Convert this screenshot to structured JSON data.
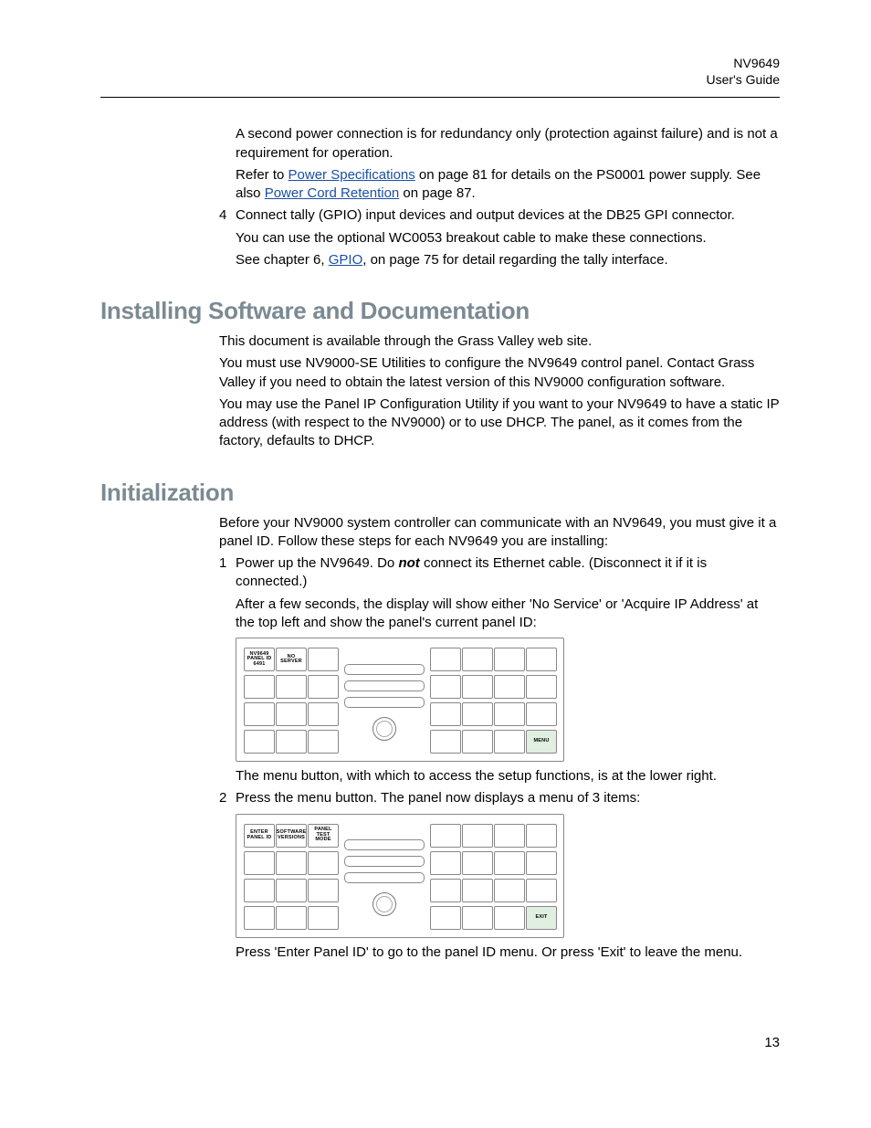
{
  "header": {
    "product": "NV9649",
    "doc": "User's Guide"
  },
  "intro": {
    "p1": "A second power connection is for redundancy only (protection against failure) and is not a requirement for operation.",
    "p2_a": "Refer to ",
    "p2_link1": "Power Specifications",
    "p2_b": " on page 81 for details on the PS0001 power supply. See also ",
    "p2_link2": "Power Cord Retention",
    "p2_c": " on page 87."
  },
  "step4": {
    "num": "4",
    "line1": "Connect tally (GPIO) input devices and output devices at the DB25 GPI connector.",
    "line2": "You can use the optional WC0053 breakout cable to make these connections.",
    "line3_a": "See chapter 6, ",
    "line3_link": "GPIO",
    "line3_b": ", on page 75 for detail regarding the tally interface."
  },
  "install": {
    "title": "Installing Software and Documentation",
    "p1": "This document is available through the Grass Valley web site.",
    "p2": "You must use NV9000-SE Utilities to configure the NV9649 control panel. Contact Grass Valley if you need to obtain the latest version of this NV9000 configuration software.",
    "p3": "You may use the Panel IP Configuration Utility if you want to your NV9649 to have a static IP address (with respect to the NV9000) or to use DHCP. The panel, as it comes from the factory, defaults to DHCP."
  },
  "init": {
    "title": "Initialization",
    "p1": "Before your NV9000 system controller can communicate with an NV9649, you must give it a panel ID. Follow these steps for each NV9649 you are installing:",
    "s1_num": "1",
    "s1_a": "Power up the NV9649. Do ",
    "s1_not": "not",
    "s1_b": " connect its Ethernet cable. (Disconnect it if it is connected.)",
    "s1_p2": "After a few seconds, the display will show either 'No Service' or 'Acquire IP Address' at the top left and show the panel's current panel ID:",
    "panel1": {
      "b1_l1": "NV9649",
      "b1_l2": "PANEL ID",
      "b1_l3": "6491",
      "b2_l1": "NO",
      "b2_l2": "SERVER",
      "menu": "MENU"
    },
    "s1_after": "The menu button, with which to access the setup functions, is at the lower right.",
    "s2_num": "2",
    "s2": "Press the menu button. The panel now displays a menu of 3 items:",
    "panel2": {
      "b1_l1": "ENTER",
      "b1_l2": "PANEL ID",
      "b2_l1": "SOFTWARE",
      "b2_l2": "VERSIONS",
      "b3_l1": "PANEL",
      "b3_l2": "TEST",
      "b3_l3": "MODE",
      "exit": "EXIT"
    },
    "s2_after": "Press 'Enter Panel ID' to go to the panel ID menu. Or press 'Exit' to leave the menu."
  },
  "pagenum": "13"
}
